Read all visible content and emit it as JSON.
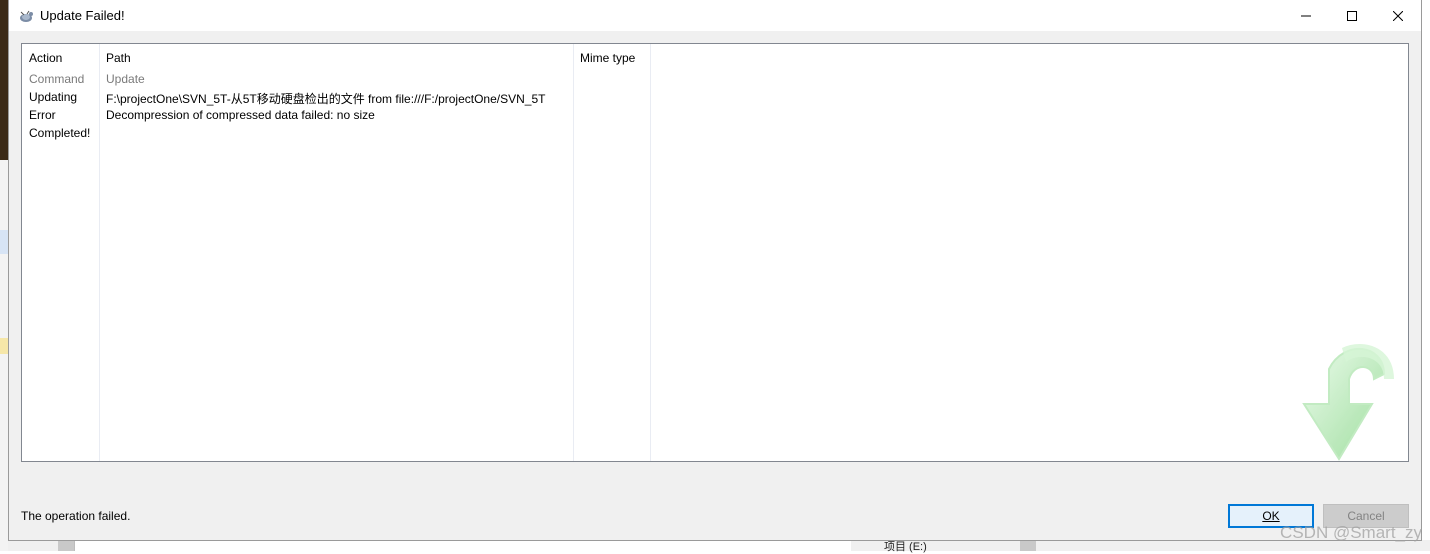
{
  "window": {
    "title": "Update Failed!",
    "controls": {
      "minimize": "—",
      "maximize": "☐",
      "close": "✕"
    }
  },
  "list": {
    "columns": [
      "Action",
      "Path",
      "Mime type"
    ],
    "rows": [
      {
        "action": "Command",
        "path": "Update",
        "mime": "",
        "style": "muted"
      },
      {
        "action": "Updating",
        "path": "F:\\projectOne\\SVN_5T-从5T移动硬盘检出的文件 from file:///F:/projectOne/SVN_5T",
        "mime": ""
      },
      {
        "action": "Error",
        "path": "Decompression of compressed data failed: no size",
        "mime": ""
      },
      {
        "action": "Completed!",
        "path": "",
        "mime": ""
      }
    ]
  },
  "status": {
    "message": "The operation failed."
  },
  "buttons": {
    "ok": "OK",
    "cancel": "Cancel"
  },
  "background": {
    "drive_label": "项目 (E:)"
  },
  "watermark": "CSDN @Smart_zy",
  "colors": {
    "ok_border": "#0078d7",
    "arrow_green": "#9be39b",
    "muted_text": "#7a7a7a"
  },
  "icons": [
    "tortoisesvn-icon",
    "minimize-icon",
    "maximize-icon",
    "close-icon",
    "update-arrow-icon",
    "drive-icon"
  ]
}
